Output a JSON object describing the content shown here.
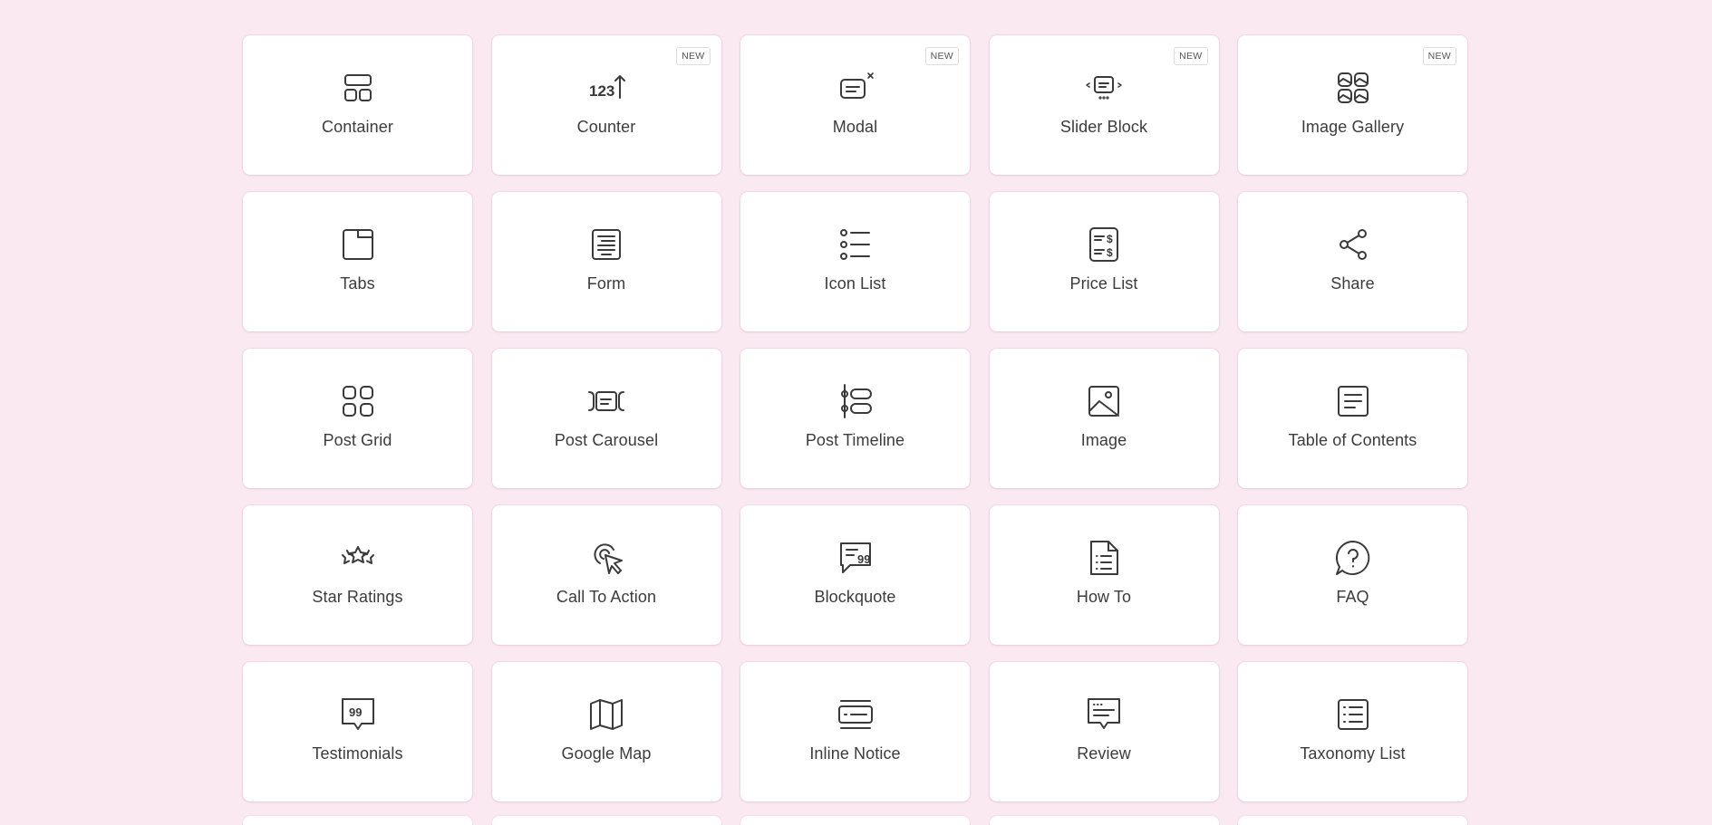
{
  "badge_text": "NEW",
  "colors": {
    "background": "#fbe9f2",
    "card": "#ffffff",
    "icon": "#3a3a3a",
    "label": "#3c3c3c"
  },
  "blocks": [
    {
      "label": "Container",
      "icon": "container-icon",
      "is_new": false
    },
    {
      "label": "Counter",
      "icon": "counter-icon",
      "is_new": true
    },
    {
      "label": "Modal",
      "icon": "modal-icon",
      "is_new": true
    },
    {
      "label": "Slider Block",
      "icon": "slider-icon",
      "is_new": true
    },
    {
      "label": "Image Gallery",
      "icon": "gallery-icon",
      "is_new": true
    },
    {
      "label": "Tabs",
      "icon": "tabs-icon",
      "is_new": false
    },
    {
      "label": "Form",
      "icon": "form-icon",
      "is_new": false
    },
    {
      "label": "Icon List",
      "icon": "icon-list-icon",
      "is_new": false
    },
    {
      "label": "Price List",
      "icon": "price-list-icon",
      "is_new": false
    },
    {
      "label": "Share",
      "icon": "share-icon",
      "is_new": false
    },
    {
      "label": "Post Grid",
      "icon": "post-grid-icon",
      "is_new": false
    },
    {
      "label": "Post Carousel",
      "icon": "carousel-icon",
      "is_new": false
    },
    {
      "label": "Post Timeline",
      "icon": "timeline-icon",
      "is_new": false
    },
    {
      "label": "Image",
      "icon": "image-icon",
      "is_new": false
    },
    {
      "label": "Table of Contents",
      "icon": "toc-icon",
      "is_new": false
    },
    {
      "label": "Star Ratings",
      "icon": "stars-icon",
      "is_new": false
    },
    {
      "label": "Call To Action",
      "icon": "cursor-click-icon",
      "is_new": false
    },
    {
      "label": "Blockquote",
      "icon": "quote-bubble-icon",
      "is_new": false
    },
    {
      "label": "How To",
      "icon": "document-list-icon",
      "is_new": false
    },
    {
      "label": "FAQ",
      "icon": "question-bubble-icon",
      "is_new": false
    },
    {
      "label": "Testimonials",
      "icon": "testimonial-icon",
      "is_new": false
    },
    {
      "label": "Google Map",
      "icon": "map-icon",
      "is_new": false
    },
    {
      "label": "Inline Notice",
      "icon": "notice-icon",
      "is_new": false
    },
    {
      "label": "Review",
      "icon": "review-icon",
      "is_new": false
    },
    {
      "label": "Taxonomy List",
      "icon": "taxonomy-icon",
      "is_new": false
    }
  ]
}
